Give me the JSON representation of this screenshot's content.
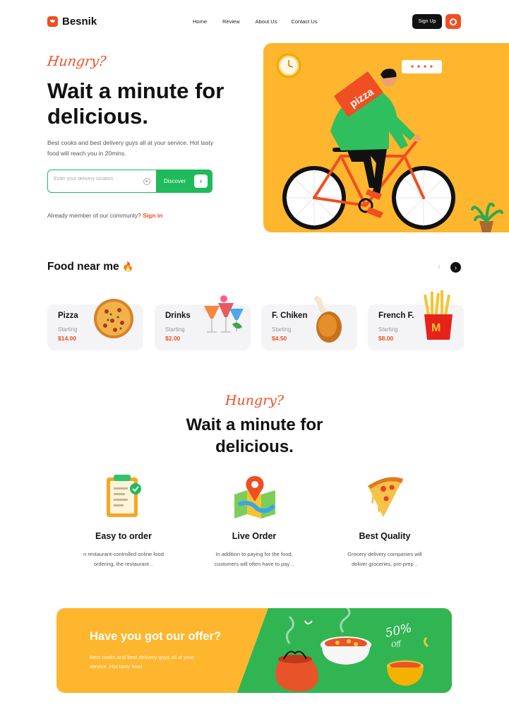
{
  "brand": {
    "name": "Besnik"
  },
  "nav": {
    "items": [
      "Home",
      "Review",
      "About Us",
      "Contact Us"
    ],
    "signup_label": "Sign Up"
  },
  "hero": {
    "script": "Hungry?",
    "title": "Wait a minute for delicious.",
    "description": "Best cooks and best delivery guys all at your service. Hot tasty food will reach you in 20mins.",
    "search_placeholder": "Enter your delivery location",
    "discover_label": "Discover",
    "member_text": "Already member of our communty?",
    "signin_label": "Sign in",
    "image_text": "pizza"
  },
  "food_section": {
    "title": "Food near me",
    "cards": [
      {
        "name": "Pizza",
        "starting": "Starting",
        "price": "$14.00"
      },
      {
        "name": "Drinks",
        "starting": "Starting",
        "price": "$2.00"
      },
      {
        "name": "F. Chiken",
        "starting": "Starting",
        "price": "$4.50"
      },
      {
        "name": "French F.",
        "starting": "Starting",
        "price": "$8.00"
      }
    ]
  },
  "features_section": {
    "script": "Hungry?",
    "title_line1": "Wait a minute for",
    "title_line2": "delicious.",
    "features": [
      {
        "title": "Easy to order",
        "desc_line1": "n restaurant-controlled online food",
        "desc_line2": "ordering, the restaurant .."
      },
      {
        "title": "Live Order",
        "desc_line1": "In addition to paying for the food,",
        "desc_line2": "customers will often have to pay .."
      },
      {
        "title": "Best Quality",
        "desc_line1": "Grocery delivery companies will",
        "desc_line2": "deliver groceries, pre-prep .."
      }
    ]
  },
  "offer": {
    "title": "Have you got our offer?",
    "desc_line1": "Best cooks and best delivery guys all at your",
    "desc_line2": "service. Hot tasty food",
    "badge_percent": "50%",
    "badge_off": "Off"
  },
  "colors": {
    "accent": "#f04e23",
    "yellow": "#fdb62e",
    "green": "#1fba5b",
    "dark": "#111111"
  }
}
